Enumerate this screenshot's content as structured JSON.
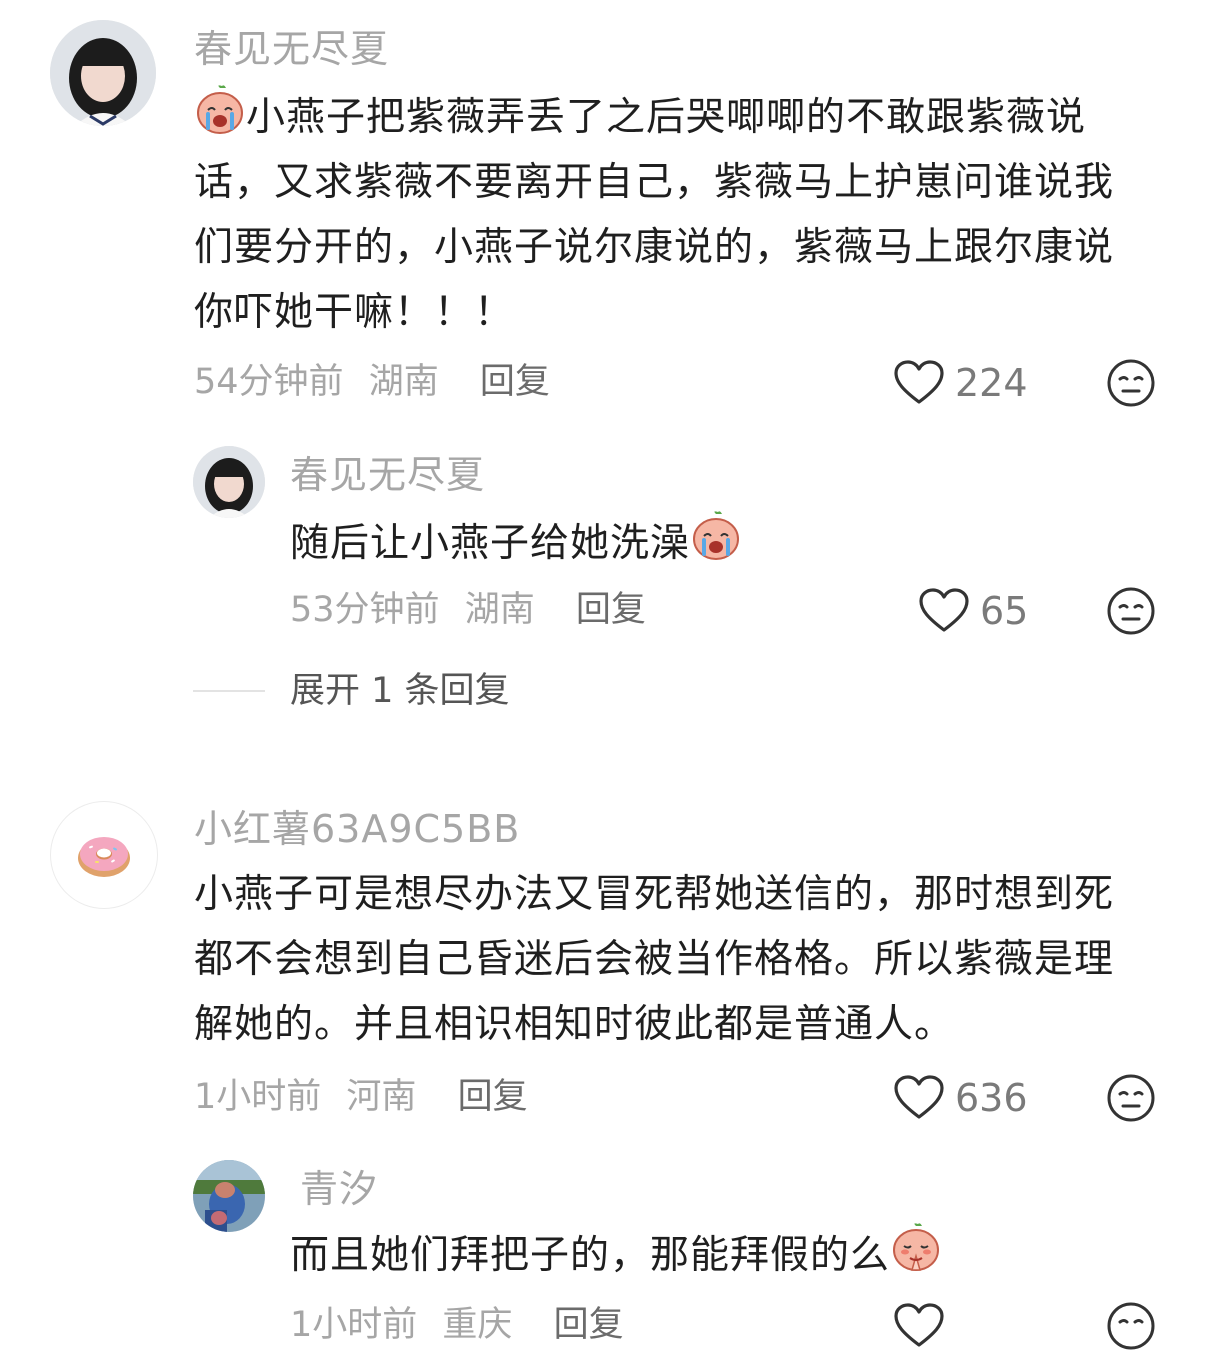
{
  "comments": [
    {
      "username": "春见无尽夏",
      "lines": [
        "小燕子把紫薇弄丢了之后哭唧唧的不敢跟紫薇说",
        "话，又求紫薇不要离开自己，紫薇马上护崽问谁说我",
        "们要分开的，小燕子说尔康说的，紫薇马上跟尔康说",
        "你吓她干嘛！！！"
      ],
      "emoji": "crying-emoji",
      "time": "54分钟前",
      "location": "湖南",
      "reply_label": "回复",
      "likes": "224",
      "replies": [
        {
          "username": "春见无尽夏",
          "text": "随后让小燕子给她洗澡",
          "emoji": "crying-emoji",
          "time": "53分钟前",
          "location": "湖南",
          "reply_label": "回复",
          "likes": "65"
        }
      ],
      "expand_label": "展开 1 条回复"
    },
    {
      "username": "小红薯63A9C5BB",
      "lines": [
        "小燕子可是想尽办法又冒死帮她送信的，那时想到死",
        "都不会想到自己昏迷后会被当作格格。所以紫薇是理",
        "解她的。并且相识相知时彼此都是普通人。"
      ],
      "time": "1小时前",
      "location": "河南",
      "reply_label": "回复",
      "likes": "636",
      "replies": [
        {
          "username": "青汐",
          "text": "而且她们拜把子的，那能拜假的么",
          "emoji": "praying-emoji",
          "time": "1小时前",
          "location": "重庆",
          "reply_label": "回复"
        }
      ]
    }
  ]
}
